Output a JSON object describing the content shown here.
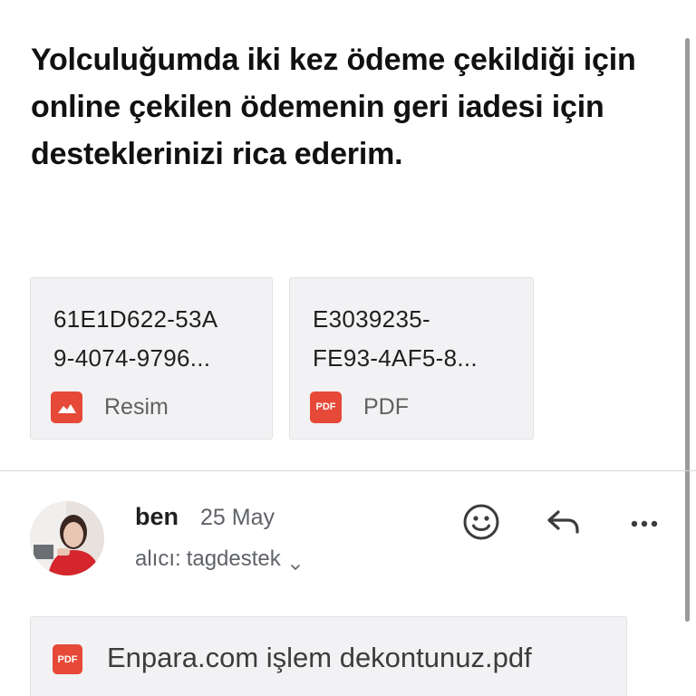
{
  "message": {
    "body_text": "Yolculuğumda iki kez ödeme çekildiği için online çekilen ödemenin geri iadesi için desteklerinizi rica ederim."
  },
  "attachments": [
    {
      "name": "61E1D622-53A\n9-4074-9796...",
      "type_label": "Resim",
      "icon": "image-icon"
    },
    {
      "name": "E3039235-\nFE93-4AF5-8...",
      "type_label": "PDF",
      "icon": "pdf-icon"
    }
  ],
  "reply_message": {
    "sender": "ben",
    "date": "25 May",
    "recipient_prefix": "alıcı:",
    "recipient": "tagdestek",
    "actions": {
      "emoji_icon": "smiley-icon",
      "reply_icon": "reply-icon",
      "more_icon": "more-horizontal-icon"
    },
    "attachment": {
      "name": "Enpara.com işlem dekontunuz.pdf",
      "icon_label": "PDF"
    }
  },
  "colors": {
    "pdf_red": "#e64937",
    "card_background": "#f2f2f4",
    "secondary_text": "#5f6368"
  }
}
